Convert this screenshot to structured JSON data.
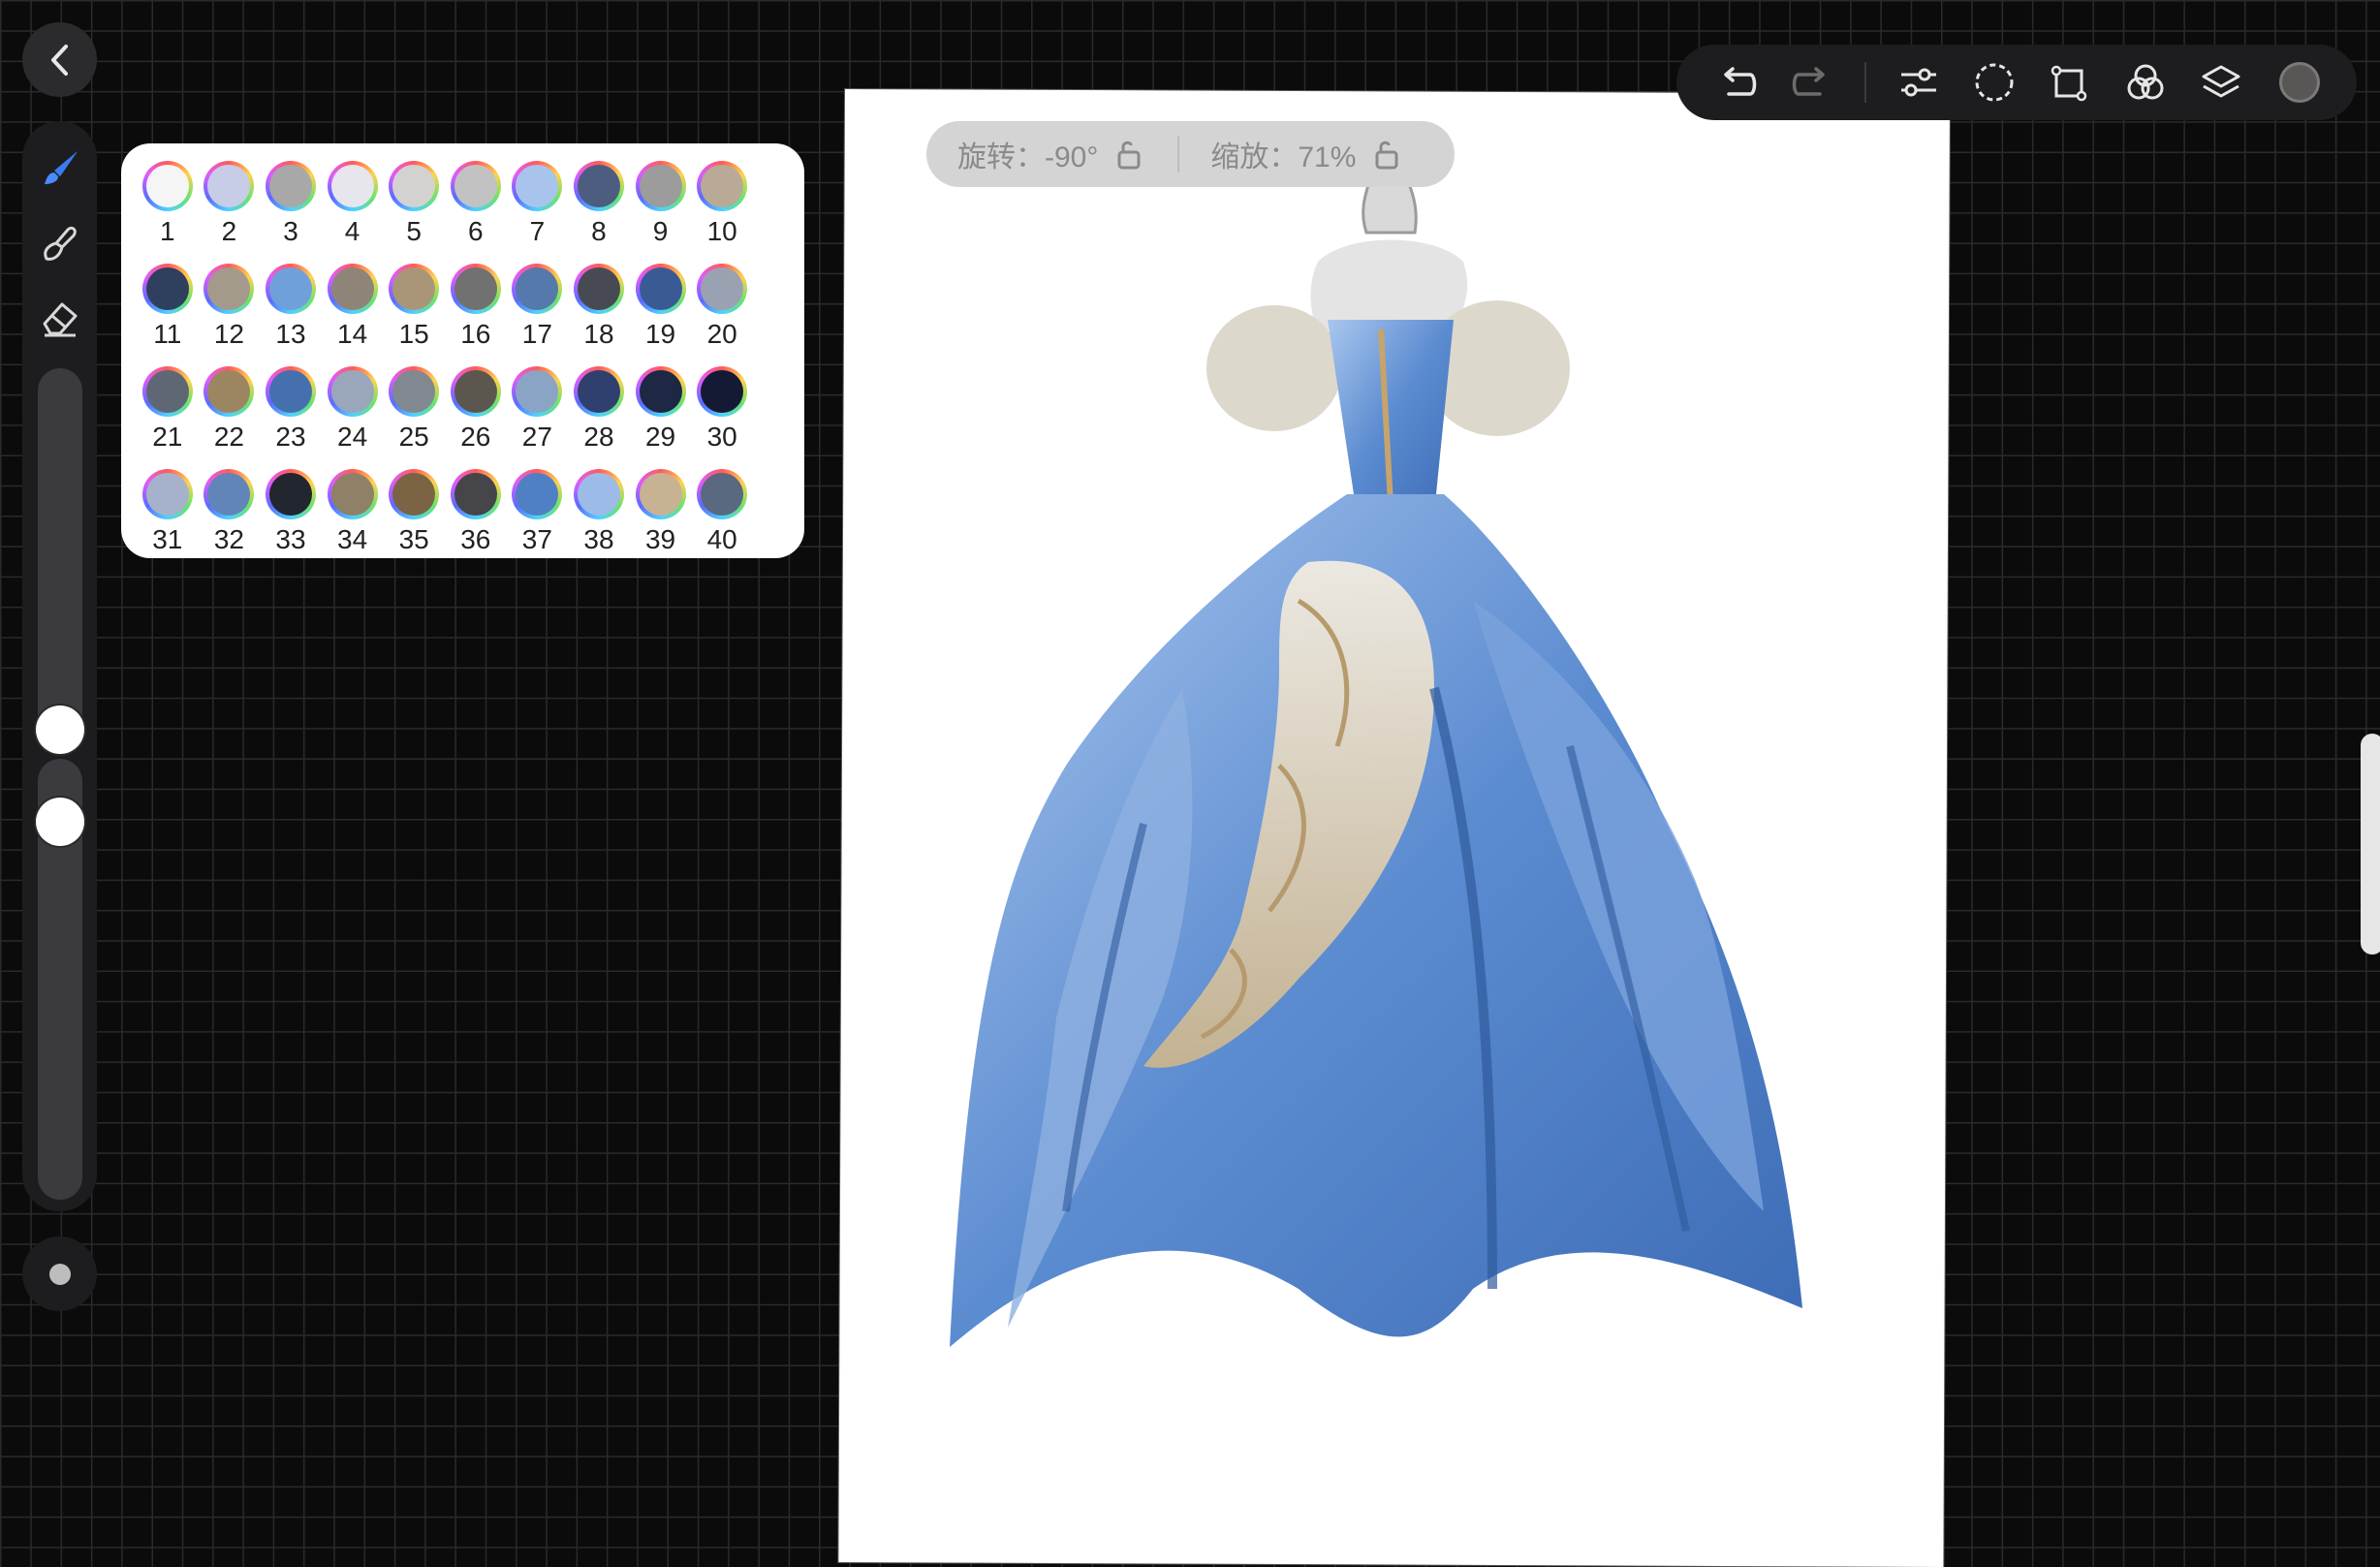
{
  "palette": {
    "swatches": [
      {
        "label": "1",
        "color": "#f5f5f5"
      },
      {
        "label": "2",
        "color": "#c7cde6"
      },
      {
        "label": "3",
        "color": "#a8a8a8"
      },
      {
        "label": "4",
        "color": "#e6e6ec"
      },
      {
        "label": "5",
        "color": "#d4d2d0"
      },
      {
        "label": "6",
        "color": "#c2c2c2"
      },
      {
        "label": "7",
        "color": "#a9c4ec"
      },
      {
        "label": "8",
        "color": "#4c5d80"
      },
      {
        "label": "9",
        "color": "#9c9c9c"
      },
      {
        "label": "10",
        "color": "#b8aa96"
      },
      {
        "label": "11",
        "color": "#2f3f5e"
      },
      {
        "label": "12",
        "color": "#a49a8c"
      },
      {
        "label": "13",
        "color": "#6fa0da"
      },
      {
        "label": "14",
        "color": "#8e8578"
      },
      {
        "label": "15",
        "color": "#a99679"
      },
      {
        "label": "16",
        "color": "#717171"
      },
      {
        "label": "17",
        "color": "#5579aa"
      },
      {
        "label": "18",
        "color": "#474a52"
      },
      {
        "label": "19",
        "color": "#3a5a96"
      },
      {
        "label": "20",
        "color": "#9aa2b2"
      },
      {
        "label": "21",
        "color": "#5f6775"
      },
      {
        "label": "22",
        "color": "#9c8662"
      },
      {
        "label": "23",
        "color": "#466fae"
      },
      {
        "label": "24",
        "color": "#9aa6bc"
      },
      {
        "label": "25",
        "color": "#818890"
      },
      {
        "label": "26",
        "color": "#5b574e"
      },
      {
        "label": "27",
        "color": "#8aa4c6"
      },
      {
        "label": "28",
        "color": "#2f3f6e"
      },
      {
        "label": "29",
        "color": "#1e2744"
      },
      {
        "label": "30",
        "color": "#141a34"
      },
      {
        "label": "31",
        "color": "#a6b2cc"
      },
      {
        "label": "32",
        "color": "#6185b8"
      },
      {
        "label": "33",
        "color": "#22262e"
      },
      {
        "label": "34",
        "color": "#8f8068"
      },
      {
        "label": "35",
        "color": "#7a6444"
      },
      {
        "label": "36",
        "color": "#45454a"
      },
      {
        "label": "37",
        "color": "#4f80c4"
      },
      {
        "label": "38",
        "color": "#9cbbe6"
      },
      {
        "label": "39",
        "color": "#c8b294"
      },
      {
        "label": "40",
        "color": "#5a6880"
      }
    ]
  },
  "status": {
    "rotation": "旋转：-90°",
    "zoom": "缩放：71%"
  },
  "toolbar": {
    "icons": [
      "undo-icon",
      "redo-icon",
      "adjustments-icon",
      "selection-icon",
      "transform-icon",
      "blend-icon",
      "layers-icon"
    ],
    "current_color": "#5b5656"
  },
  "sidebar": {
    "tools": [
      "brush-icon",
      "smudge-icon",
      "eraser-icon"
    ],
    "brush_size_level": 0.42,
    "opacity_level": 0.5
  }
}
